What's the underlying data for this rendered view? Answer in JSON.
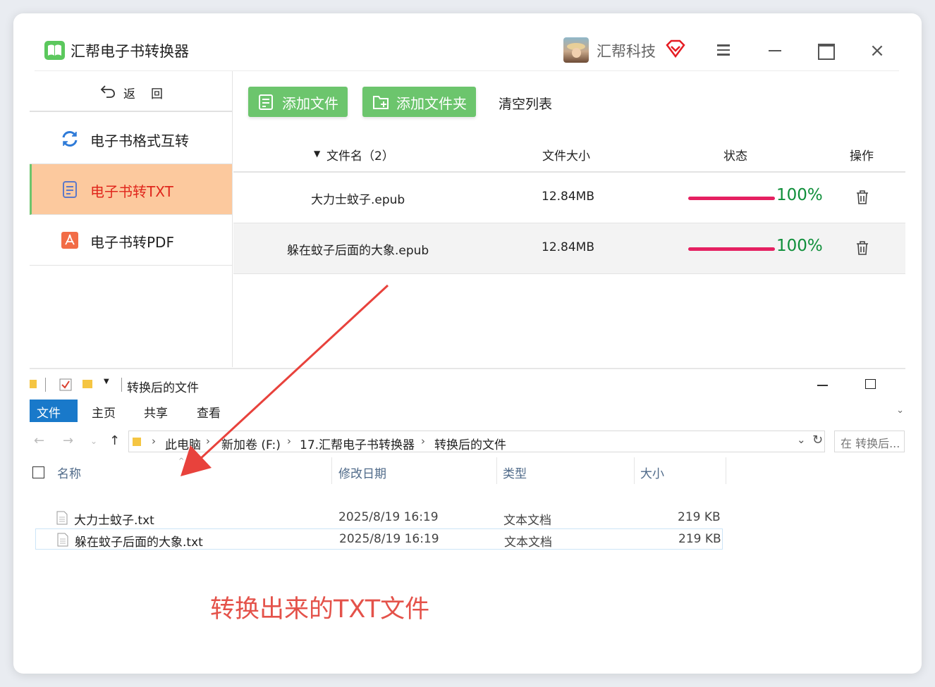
{
  "app": {
    "title": "汇帮电子书转换器",
    "company": "汇帮科技",
    "colors": {
      "brand_green": "#6cc56d",
      "active_bg": "#fcc99e",
      "active_text": "#e0261c",
      "progress": "#e52061",
      "percent": "#0f8f3a"
    }
  },
  "sidebar": {
    "back_label": "返回",
    "items": [
      {
        "label": "电子书格式互转",
        "icon": "refresh-icon",
        "active": false
      },
      {
        "label": "电子书转TXT",
        "icon": "document-icon",
        "active": true
      },
      {
        "label": "电子书转PDF",
        "icon": "pdf-icon",
        "active": false
      }
    ]
  },
  "toolbar": {
    "add_file": "添加文件",
    "add_folder": "添加文件夹",
    "clear_list": "清空列表"
  },
  "file_table": {
    "headers": {
      "name": "文件名（2）",
      "size": "文件大小",
      "status": "状态",
      "action": "操作"
    },
    "rows": [
      {
        "name": "大力士蚊子.epub",
        "size": "12.84MB",
        "progress": 100,
        "percent_text": "100%"
      },
      {
        "name": "躲在蚊子后面的大象.epub",
        "size": "12.84MB",
        "progress": 100,
        "percent_text": "100%"
      }
    ]
  },
  "explorer": {
    "title": "转换后的文件",
    "ribbon_tabs": [
      "文件",
      "主页",
      "共享",
      "查看"
    ],
    "breadcrumb": [
      "此电脑",
      "新加卷 (F:)",
      "17.汇帮电子书转换器",
      "转换后的文件"
    ],
    "search_placeholder": "在 转换后...",
    "columns": {
      "name": "名称",
      "modified": "修改日期",
      "type": "类型",
      "size": "大小"
    },
    "files": [
      {
        "name": "大力士蚊子.txt",
        "modified": "2025/8/19 16:19",
        "type": "文本文档",
        "size": "219 KB"
      },
      {
        "name": "躲在蚊子后面的大象.txt",
        "modified": "2025/8/19 16:19",
        "type": "文本文档",
        "size": "219 KB"
      }
    ]
  },
  "annotation": {
    "text": "转换出来的TXT文件"
  }
}
